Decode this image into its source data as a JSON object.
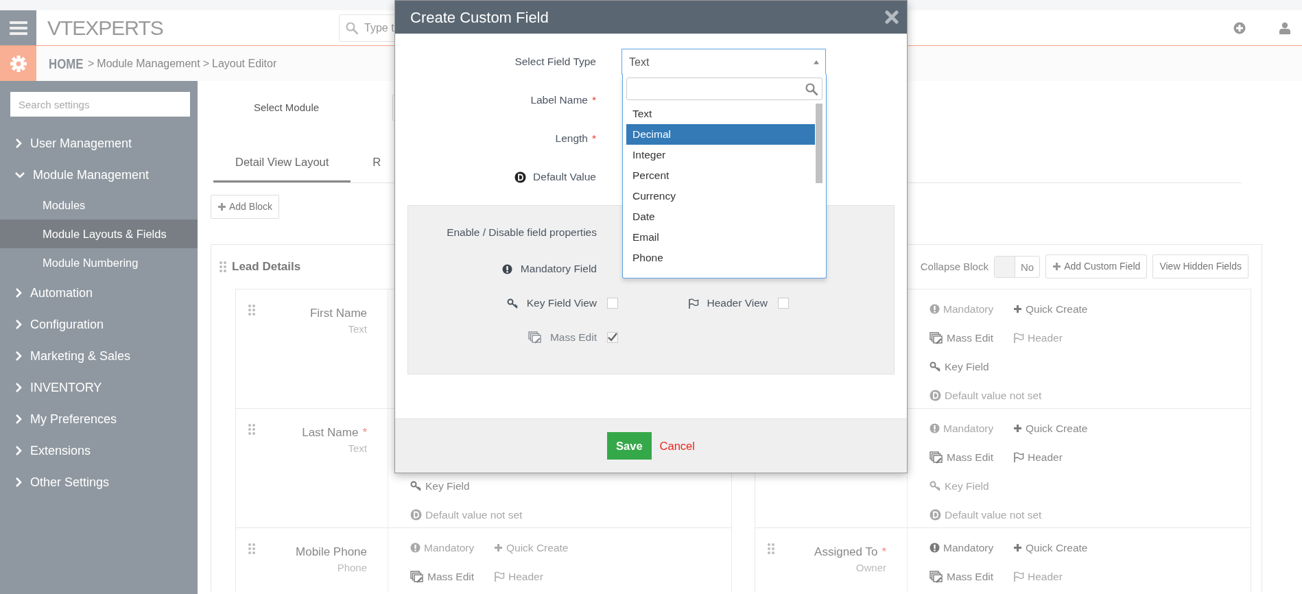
{
  "top_bar": {
    "logo": "VTEXPERTS",
    "search_placeholder": "Type t"
  },
  "breadcrumb": [
    {
      "kind": "home",
      "label": "HOME"
    },
    {
      "kind": "sep",
      "label": ">"
    },
    {
      "kind": "crumb",
      "label": "Module Management"
    },
    {
      "kind": "sep",
      "label": ">"
    },
    {
      "kind": "crumb",
      "label": "Layout Editor"
    }
  ],
  "sidebar": {
    "search_placeholder": "Search settings",
    "items": [
      {
        "label": "User Management",
        "expanded": false
      },
      {
        "label": "Module Management",
        "expanded": true,
        "children": [
          {
            "label": "Modules",
            "selected": false
          },
          {
            "label": "Module Layouts & Fields",
            "selected": true
          },
          {
            "label": "Module Numbering",
            "selected": false
          }
        ]
      },
      {
        "label": "Automation",
        "expanded": false
      },
      {
        "label": "Configuration",
        "expanded": false
      },
      {
        "label": "Marketing & Sales",
        "expanded": false
      },
      {
        "label": "INVENTORY",
        "expanded": false
      },
      {
        "label": "My Preferences",
        "expanded": false
      },
      {
        "label": "Extensions",
        "expanded": false
      },
      {
        "label": "Other Settings",
        "expanded": false
      }
    ]
  },
  "module_select": {
    "label": "Select Module"
  },
  "tabs": [
    {
      "label": "Detail View Layout",
      "selected": true
    },
    {
      "label": "R",
      "selected": false
    }
  ],
  "add_block": "Add Block",
  "block": {
    "title": "Lead Details",
    "collapse_label": "Collapse Block",
    "collapse_toggle": "No",
    "add_field": "Add Custom Field",
    "hidden_fields": "View Hidden Fields",
    "columns": [
      [
        {
          "label": "First Name",
          "type": "Text"
        },
        {
          "label": "Last Name",
          "required_mark": "*",
          "type": "Text",
          "properties": [
            {
              "kind": "key",
              "label": "Key Field",
              "enabled": true
            },
            {
              "kind": "default",
              "label": "Default value not set",
              "enabled": false
            }
          ]
        },
        {
          "label": "Mobile Phone",
          "type": "Phone",
          "properties": [
            {
              "kind": "mandatory",
              "label": "Mandatory",
              "enabled": false
            },
            {
              "kind": "quick",
              "label": "Quick Create",
              "enabled": false
            },
            {
              "kind": "mass",
              "label": "Mass Edit",
              "enabled": true
            },
            {
              "kind": "header",
              "label": "Header",
              "enabled": false
            }
          ]
        }
      ],
      [
        {
          "properties": [
            {
              "kind": "mandatory",
              "label": "Mandatory",
              "enabled": false
            },
            {
              "kind": "quick",
              "label": "Quick Create",
              "enabled": true
            },
            {
              "kind": "mass",
              "label": "Mass Edit",
              "enabled": true
            },
            {
              "kind": "header",
              "label": "Header",
              "enabled": false
            },
            {
              "kind": "key",
              "label": "Key Field",
              "enabled": true
            },
            {
              "kind": "default",
              "label": "Default value not set",
              "enabled": false
            }
          ]
        },
        {
          "properties": [
            {
              "kind": "mandatory",
              "label": "Mandatory",
              "enabled": false
            },
            {
              "kind": "quick",
              "label": "Quick Create",
              "enabled": true
            },
            {
              "kind": "mass",
              "label": "Mass Edit",
              "enabled": true
            },
            {
              "kind": "header",
              "label": "Header",
              "enabled": true
            },
            {
              "kind": "key",
              "label": "Key Field",
              "enabled": false
            },
            {
              "kind": "default",
              "label": "Default value not set",
              "enabled": false
            }
          ]
        },
        {
          "label": "Assigned To",
          "required_mark": "*",
          "type": "Owner",
          "properties": [
            {
              "kind": "mandatory",
              "label": "Mandatory",
              "enabled": true
            },
            {
              "kind": "quick",
              "label": "Quick Create",
              "enabled": true
            },
            {
              "kind": "mass",
              "label": "Mass Edit",
              "enabled": true
            },
            {
              "kind": "header",
              "label": "Header",
              "enabled": false
            }
          ]
        }
      ]
    ]
  },
  "modal": {
    "title": "Create Custom Field",
    "form": [
      {
        "kind": "select",
        "label": "Select Field Type",
        "value": "Text"
      },
      {
        "kind": "text",
        "label": "Label Name",
        "required_mark": "*"
      },
      {
        "kind": "text",
        "label": "Length",
        "required_mark": "*"
      },
      {
        "kind": "default",
        "label": "Default Value"
      }
    ],
    "dropdown": {
      "options": [
        {
          "label": "Text",
          "selected": false
        },
        {
          "label": "Decimal",
          "selected": true
        },
        {
          "label": "Integer",
          "selected": false
        },
        {
          "label": "Percent",
          "selected": false
        },
        {
          "label": "Currency",
          "selected": false
        },
        {
          "label": "Date",
          "selected": false
        },
        {
          "label": "Email",
          "selected": false
        },
        {
          "label": "Phone",
          "selected": false
        }
      ]
    },
    "properties": {
      "title": "Enable / Disable field properties",
      "rows": [
        [
          {
            "kind": "mandatory",
            "label": "Mandatory Field",
            "disabled": false
          }
        ],
        [
          {
            "kind": "key",
            "label": "Key Field View",
            "checked": false,
            "disabled": false
          },
          {
            "kind": "header",
            "label": "Header View",
            "checked": false,
            "disabled": false
          }
        ],
        [
          {
            "kind": "mass",
            "label": "Mass Edit",
            "checked": true,
            "disabled": true
          }
        ]
      ]
    },
    "save": "Save",
    "cancel": "Cancel"
  }
}
